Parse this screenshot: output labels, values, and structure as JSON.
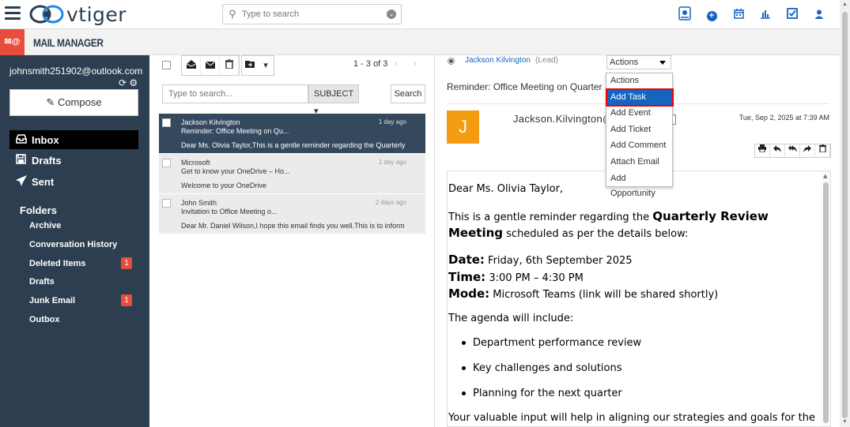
{
  "app": {
    "name": "vtiger",
    "module_title": "MAIL MANAGER",
    "module_icon": "mail-at-icon"
  },
  "global_search": {
    "placeholder": "Type to search"
  },
  "top_icons": [
    "voice-icon",
    "add-icon",
    "calendar-icon",
    "reports-icon",
    "tasks-icon",
    "user-icon"
  ],
  "account": {
    "email": "johnsmith251902@outlook.com"
  },
  "compose_label": "Compose",
  "nav": [
    {
      "label": "Inbox",
      "icon": "inbox-icon",
      "active": true
    },
    {
      "label": "Drafts",
      "icon": "drafts-icon",
      "active": false
    },
    {
      "label": "Sent",
      "icon": "sent-icon",
      "active": false
    }
  ],
  "folders_heading": "Folders",
  "folders": [
    {
      "label": "Archive",
      "badge": ""
    },
    {
      "label": "Conversation History",
      "badge": ""
    },
    {
      "label": "Deleted Items",
      "badge": "1"
    },
    {
      "label": "Drafts",
      "badge": ""
    },
    {
      "label": "Junk Email",
      "badge": "1"
    },
    {
      "label": "Outbox",
      "badge": ""
    }
  ],
  "list": {
    "count": "1 - 3 of 3",
    "prev": "‹",
    "next": "›",
    "search_placeholder": "Type to search...",
    "filter": "SUBJECT",
    "search_button": "Search",
    "mails": [
      {
        "from": "Jackson Kilvington",
        "date": "1 day ago",
        "subject": "Reminder: Office Meeting on Qu...",
        "preview": "Dear Ms. Olivia Taylor,This is a gentle reminder regarding the Quarterly",
        "selected": true
      },
      {
        "from": "Microsoft",
        "date": "1 day ago",
        "subject": "Get to know your OneDrive – Ho...",
        "preview": "Welcome to your OneDrive",
        "selected": false
      },
      {
        "from": "John Smith",
        "date": "2 days ago",
        "subject": "Invitation to Office Meeting o...",
        "preview": "Dear Mr. Daniel Wilson,I hope this email finds you well.This is to inform",
        "selected": false
      }
    ]
  },
  "reader": {
    "contact": "Jackson Kilvington",
    "contact_type": "(Lead)",
    "actions_label": "Actions",
    "subject": "Reminder: Office Meeting on Quarter",
    "avatar_letter": "J",
    "from": "Jackson.Kilvington@",
    "date": "Tue, Sep 2, 2025 at 7:39 AM",
    "body": {
      "greeting": "Dear Ms. Olivia Taylor,",
      "p1a": "This is a gentle reminder regarding the ",
      "p1b": "Quarterly Review",
      "p1c": "Meeting",
      "p1d": " scheduled as per the details below:",
      "date_label": "Date:",
      "date_value": " Friday, 6th September 2025",
      "time_label": "Time:",
      "time_value": " 3:00 PM – 4:30 PM",
      "mode_label": "Mode:",
      "mode_value": " Microsoft Teams (link will be shared shortly)",
      "agenda_intro": "The agenda will include:",
      "agenda": [
        "Department performance review",
        "Key challenges and solutions",
        "Planning for the next quarter"
      ],
      "closing": "Your valuable input will help in aligning our strategies and goals for the"
    }
  },
  "actions_menu": [
    "Actions",
    "Add Task",
    "Add Event",
    "Add Ticket",
    "Add Comment",
    "Attach Email",
    "Add Opportunity"
  ],
  "highlighted_action": "Add Task",
  "colors": {
    "sidebar": "#2c3e50",
    "accent": "#e74c3c",
    "link": "#1565c0",
    "selected_row": "#34495e",
    "avatar": "#f39c12"
  }
}
